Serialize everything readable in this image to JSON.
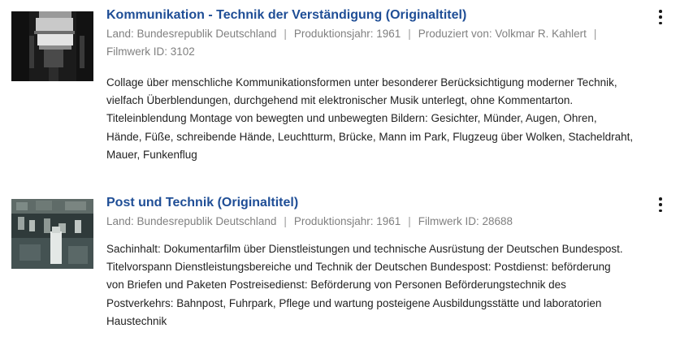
{
  "results": [
    {
      "title": "Kommunikation - Technik der Verständigung (Originaltitel)",
      "meta": [
        "Land: Bundesrepublik Deutschland",
        "Produktionsjahr: 1961",
        "Produziert von: Volkmar R. Kahlert",
        "Filmwerk ID: 3102"
      ],
      "description_lines": [
        "Collage über menschliche Kommunikationsformen unter besonderer Berücksichtigung moderner Technik,",
        "vielfach Überblendungen, durchgehend mit elektronischer Musik unterlegt, ohne Kommentarton.",
        "Titeleinblendung Montage von bewegten und unbewegten Bildern: Gesichter, Münder, Augen, Ohren,",
        "Hände, Füße, schreibende Hände, Leuchtturm, Brücke, Mann im Park, Flugzeug über Wolken, Stacheldraht,",
        "Mauer, Funkenflug"
      ]
    },
    {
      "title": "Post und Technik (Originaltitel)",
      "meta": [
        "Land: Bundesrepublik Deutschland",
        "Produktionsjahr: 1961",
        "Filmwerk ID: 28688"
      ],
      "description_lines": [
        "Sachinhalt: Dokumentarfilm über Dienstleistungen und technische Ausrüstung der Deutschen Bundespost.",
        "Titelvorspann Dienstleistungsbereiche und Technik der Deutschen Bundespost: Postdienst: beförderung",
        "von Briefen und Paketen Postreisedienst: Beförderung von Personen Beförderungstechnik des",
        "Postverkehrs: Bahnpost, Fuhrpark, Pflege und wartung posteigene Ausbildungsstätte und laboratorien",
        "Haustechnik"
      ]
    }
  ],
  "icons": {
    "menu": "more-vertical-icon",
    "separator": "|"
  },
  "colors": {
    "title": "#1f4e96",
    "meta": "#808080",
    "text": "#222222"
  }
}
